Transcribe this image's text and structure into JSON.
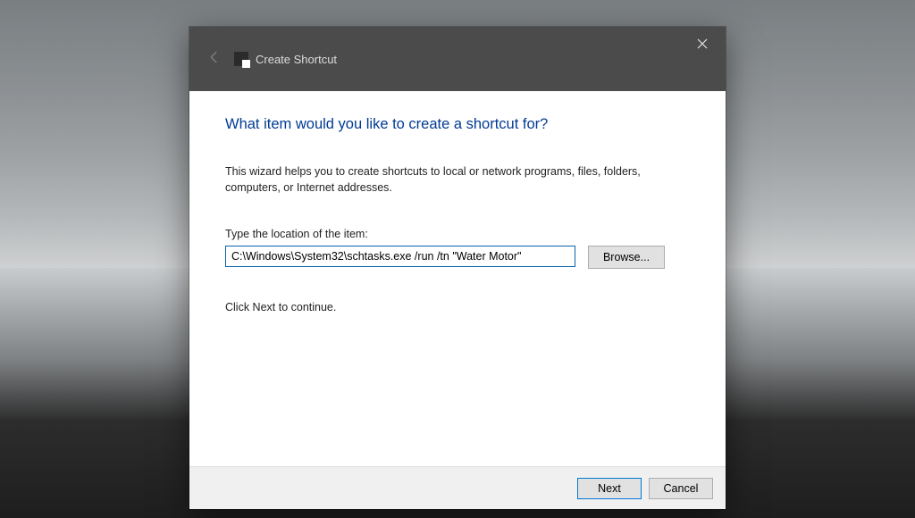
{
  "titlebar": {
    "title": "Create Shortcut"
  },
  "content": {
    "heading": "What item would you like to create a shortcut for?",
    "description": "This wizard helps you to create shortcuts to local or network programs, files, folders, computers, or Internet addresses.",
    "location_label": "Type the location of the item:",
    "location_value": "C:\\Windows\\System32\\schtasks.exe /run /tn \"Water Motor\"",
    "browse_label": "Browse...",
    "hint": "Click Next to continue."
  },
  "footer": {
    "next_label": "Next",
    "cancel_label": "Cancel"
  }
}
